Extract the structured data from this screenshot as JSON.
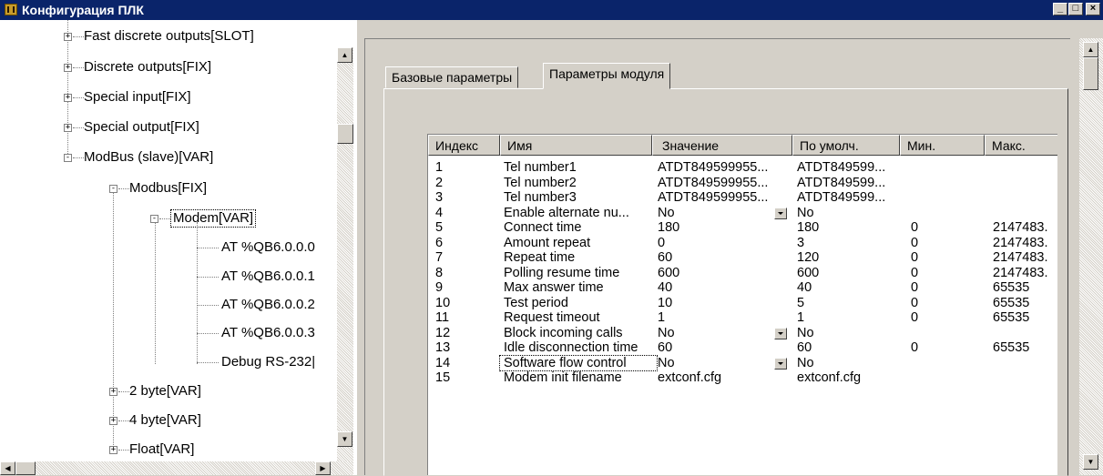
{
  "window": {
    "title": "Конфигурация ПЛК",
    "min_label": "_",
    "max_label": "□",
    "close_label": "×"
  },
  "tree": {
    "items": [
      {
        "label": "Fast discrete outputs[SLOT]",
        "box": "+"
      },
      {
        "label": "Discrete outputs[FIX]",
        "box": "+"
      },
      {
        "label": "Special input[FIX]",
        "box": "+"
      },
      {
        "label": "Special output[FIX]",
        "box": "+"
      },
      {
        "label": "ModBus (slave)[VAR]",
        "box": "-"
      },
      {
        "label": "Modbus[FIX]",
        "box": "-"
      },
      {
        "label": "Modem[VAR]",
        "box": "-"
      },
      {
        "label": "AT %QB6.0.0.0",
        "box": ""
      },
      {
        "label": "AT %QB6.0.0.1",
        "box": ""
      },
      {
        "label": "AT %QB6.0.0.2",
        "box": ""
      },
      {
        "label": "AT %QB6.0.0.3",
        "box": ""
      },
      {
        "label": "Debug RS-232|",
        "box": ""
      },
      {
        "label": "2 byte[VAR]",
        "box": "+"
      },
      {
        "label": "4 byte[VAR]",
        "box": "+"
      },
      {
        "label": "Float[VAR]",
        "box": "+"
      }
    ]
  },
  "tabs": [
    {
      "label": "Базовые параметры"
    },
    {
      "label": "Параметры модуля"
    }
  ],
  "table": {
    "headers": [
      "Индекс",
      "Имя",
      "Значение",
      "По умолч.",
      "Мин.",
      "Макс."
    ],
    "rows": [
      [
        "1",
        "Tel number1",
        "ATDT849599955...",
        "ATDT849599...",
        "",
        ""
      ],
      [
        "2",
        "Tel number2",
        "ATDT849599955...",
        "ATDT849599...",
        "",
        ""
      ],
      [
        "3",
        "Tel number3",
        "ATDT849599955...",
        "ATDT849599...",
        "",
        ""
      ],
      [
        "4",
        "Enable alternate nu...",
        "No",
        "No",
        "",
        ""
      ],
      [
        "5",
        "Connect time",
        "180",
        "180",
        "0",
        "2147483."
      ],
      [
        "6",
        "Amount repeat",
        "0",
        "3",
        "0",
        "2147483."
      ],
      [
        "7",
        "Repeat time",
        "60",
        "120",
        "0",
        "2147483."
      ],
      [
        "8",
        "Polling resume time",
        "600",
        "600",
        "0",
        "2147483."
      ],
      [
        "9",
        "Max answer time",
        "40",
        "40",
        "0",
        "65535"
      ],
      [
        "10",
        "Test period",
        "10",
        "5",
        "0",
        "65535"
      ],
      [
        "11",
        "Request timeout",
        "1",
        "1",
        "0",
        "65535"
      ],
      [
        "12",
        "Block incoming calls",
        "No",
        "No",
        "",
        ""
      ],
      [
        "13",
        "Idle disconnection time",
        "60",
        "60",
        "0",
        "65535"
      ],
      [
        "14",
        "Software flow control",
        "No",
        "No",
        "",
        ""
      ],
      [
        "15",
        "Modem init filename",
        "extconf.cfg",
        "extconf.cfg",
        "",
        ""
      ]
    ],
    "dropdown_rows": [
      3,
      11,
      13
    ]
  }
}
